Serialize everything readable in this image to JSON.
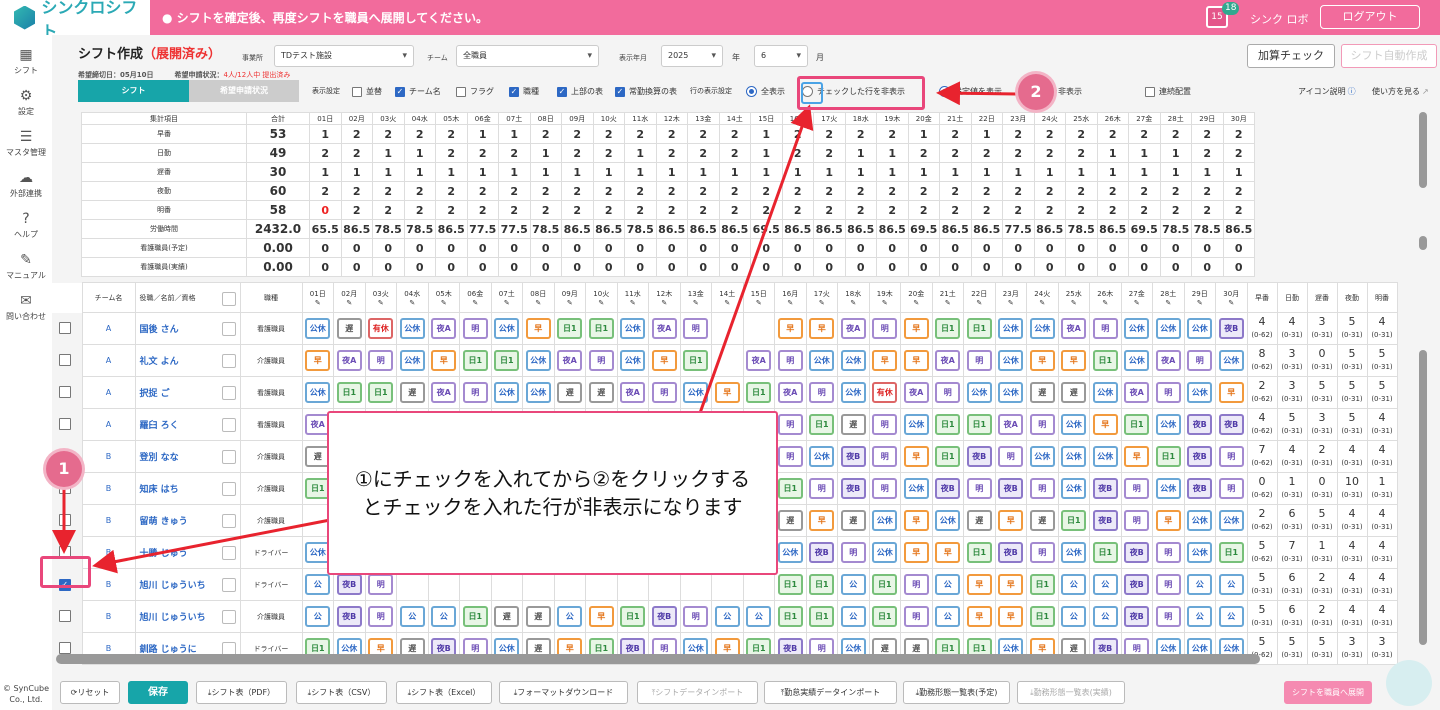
{
  "header": {
    "logo": "シンクロシフト",
    "message": "シフトを確定後、再度シフトを職員へ展開してください。",
    "cal_num": "15",
    "badge": "18",
    "user": "シンク ロボ",
    "logout": "ログアウト"
  },
  "sidebar": [
    {
      "label": "シフト",
      "icon": "calendar-icon"
    },
    {
      "label": "設定",
      "icon": "gear-icon"
    },
    {
      "label": "マスタ管理",
      "icon": "database-icon"
    },
    {
      "label": "外部連携",
      "icon": "cloud-icon"
    },
    {
      "label": "ヘルプ",
      "icon": "help-icon"
    },
    {
      "label": "マニュアル",
      "icon": "pencil-icon"
    },
    {
      "label": "問い合わせ",
      "icon": "mail-icon"
    }
  ],
  "copyright": "© SynCube Co., Ltd.",
  "page": {
    "title": "シフト作成",
    "status": "（展開済み）",
    "deadline": "希望締切日：05月10日",
    "request_label": "希望申請状況：",
    "request_value": "4人/12人中 提出済み"
  },
  "filters": {
    "office_label": "事業所",
    "office": "TDテスト施設",
    "team_label": "チーム",
    "team": "全職員",
    "ym_label": "表示年月",
    "year": "2025",
    "year_unit": "年",
    "month": "6",
    "month_unit": "月"
  },
  "buttons": {
    "calc": "加算チェック",
    "auto": "シフト自動作成"
  },
  "tabs": {
    "shift": "シフト",
    "request": "希望申請状況"
  },
  "options": {
    "display_label": "表示設定",
    "sort": "並替",
    "team_name": "チーム名",
    "flag": "フラグ",
    "job": "職種",
    "top_table": "上部の表",
    "fulltime": "常勤換算の表",
    "row_label": "行の表示設定",
    "show_all": "全表示",
    "hide_checked": "チェックした行を非表示",
    "show_set": "設定値を表示",
    "hide_set": "値を非表示",
    "consec": "連続配置",
    "icon_help": "アイコン説明",
    "usage": "使い方を見る"
  },
  "days": [
    "01日",
    "02月",
    "03火",
    "04水",
    "05木",
    "06金",
    "07土",
    "08日",
    "09月",
    "10火",
    "11水",
    "12木",
    "13金",
    "14土",
    "15日",
    "16月",
    "17火",
    "18水",
    "19木",
    "20金",
    "21土",
    "22日",
    "23月",
    "24火",
    "25水",
    "26木",
    "27金",
    "28土",
    "29日",
    "30月"
  ],
  "summary": {
    "header": "集計項目",
    "total_label": "合計",
    "rows": [
      {
        "label": "早番",
        "total": "53",
        "values": [
          "1",
          "2",
          "2",
          "2",
          "2",
          "1",
          "1",
          "2",
          "2",
          "2",
          "2",
          "2",
          "2",
          "2",
          "1",
          "2",
          "2",
          "2",
          "2",
          "1",
          "2",
          "1",
          "2",
          "2",
          "2",
          "2",
          "2",
          "2",
          "2",
          "2"
        ]
      },
      {
        "label": "日勤",
        "total": "49",
        "values": [
          "2",
          "2",
          "1",
          "1",
          "2",
          "2",
          "2",
          "1",
          "2",
          "2",
          "1",
          "2",
          "2",
          "2",
          "1",
          "2",
          "2",
          "1",
          "1",
          "2",
          "2",
          "2",
          "2",
          "2",
          "2",
          "1",
          "1",
          "1",
          "2",
          "2"
        ]
      },
      {
        "label": "遅番",
        "total": "30",
        "values": [
          "1",
          "1",
          "1",
          "1",
          "1",
          "1",
          "1",
          "1",
          "1",
          "1",
          "1",
          "1",
          "1",
          "1",
          "1",
          "1",
          "1",
          "1",
          "1",
          "1",
          "1",
          "1",
          "1",
          "1",
          "1",
          "1",
          "1",
          "1",
          "1",
          "1"
        ]
      },
      {
        "label": "夜勤",
        "total": "60",
        "values": [
          "2",
          "2",
          "2",
          "2",
          "2",
          "2",
          "2",
          "2",
          "2",
          "2",
          "2",
          "2",
          "2",
          "2",
          "2",
          "2",
          "2",
          "2",
          "2",
          "2",
          "2",
          "2",
          "2",
          "2",
          "2",
          "2",
          "2",
          "2",
          "2",
          "2"
        ]
      },
      {
        "label": "明番",
        "total": "58",
        "values": [
          "0",
          "2",
          "2",
          "2",
          "2",
          "2",
          "2",
          "2",
          "2",
          "2",
          "2",
          "2",
          "2",
          "2",
          "2",
          "2",
          "2",
          "2",
          "2",
          "2",
          "2",
          "2",
          "2",
          "2",
          "2",
          "2",
          "2",
          "2",
          "2",
          "2"
        ]
      },
      {
        "label": "労働時間",
        "total": "2432.0",
        "values": [
          "65.5",
          "86.5",
          "78.5",
          "78.5",
          "86.5",
          "77.5",
          "77.5",
          "78.5",
          "86.5",
          "86.5",
          "78.5",
          "86.5",
          "86.5",
          "86.5",
          "69.5",
          "86.5",
          "86.5",
          "86.5",
          "86.5",
          "69.5",
          "86.5",
          "86.5",
          "77.5",
          "86.5",
          "78.5",
          "86.5",
          "69.5",
          "78.5",
          "78.5",
          "86.5"
        ]
      },
      {
        "label": "看護職員(予定)",
        "total": "0.00",
        "values": [
          "0",
          "0",
          "0",
          "0",
          "0",
          "0",
          "0",
          "0",
          "0",
          "0",
          "0",
          "0",
          "0",
          "0",
          "0",
          "0",
          "0",
          "0",
          "0",
          "0",
          "0",
          "0",
          "0",
          "0",
          "0",
          "0",
          "0",
          "0",
          "0",
          "0"
        ]
      },
      {
        "label": "看護職員(実績)",
        "total": "0.00",
        "values": [
          "0",
          "0",
          "0",
          "0",
          "0",
          "0",
          "0",
          "0",
          "0",
          "0",
          "0",
          "0",
          "0",
          "0",
          "0",
          "0",
          "0",
          "0",
          "0",
          "0",
          "0",
          "0",
          "0",
          "0",
          "0",
          "0",
          "0",
          "0",
          "0",
          "0"
        ]
      }
    ]
  },
  "staff_header": {
    "team": "チーム名",
    "name": "役職／名前／資格",
    "job": "職種",
    "stats": [
      "早番",
      "日勤",
      "遅番",
      "夜勤",
      "明番"
    ]
  },
  "staff": [
    {
      "team": "A",
      "name": "国後 さん",
      "job": "看護職員",
      "checked": false,
      "shifts": [
        "公休",
        "遅",
        "有休",
        "公休",
        "夜A",
        "明",
        "公休",
        "早",
        "日1",
        "日1",
        "公休",
        "夜A",
        "明",
        "",
        "",
        "早",
        "早",
        "夜A",
        "明",
        "早",
        "日1",
        "日1",
        "公休",
        "公休",
        "夜A",
        "明",
        "公休",
        "公休",
        "公休",
        "夜B"
      ],
      "stats": [
        [
          "4",
          "(0-62)"
        ],
        [
          "4",
          "(0-31)"
        ],
        [
          "3",
          "(0-31)"
        ],
        [
          "5",
          "(0-31)"
        ],
        [
          "4",
          "(0-31)"
        ]
      ]
    },
    {
      "team": "A",
      "name": "礼文 よん",
      "job": "介護職員",
      "checked": false,
      "shifts": [
        "早",
        "夜A",
        "明",
        "公休",
        "早",
        "日1",
        "日1",
        "公休",
        "夜A",
        "明",
        "公休",
        "早",
        "日1",
        "",
        "夜A",
        "明",
        "公休",
        "公休",
        "早",
        "早",
        "夜A",
        "明",
        "公休",
        "早",
        "早",
        "日1",
        "公休",
        "夜A",
        "明",
        "公休"
      ],
      "stats": [
        [
          "8",
          "(0-62)"
        ],
        [
          "3",
          "(0-31)"
        ],
        [
          "0",
          "(0-31)"
        ],
        [
          "5",
          "(0-31)"
        ],
        [
          "5",
          "(0-31)"
        ]
      ]
    },
    {
      "team": "A",
      "name": "択捉 ご",
      "job": "看護職員",
      "checked": false,
      "shifts": [
        "公休",
        "日1",
        "日1",
        "遅",
        "夜A",
        "明",
        "公休",
        "公休",
        "遅",
        "遅",
        "夜A",
        "明",
        "公休",
        "早",
        "日1",
        "夜A",
        "明",
        "公休",
        "有休",
        "夜A",
        "明",
        "公休",
        "公休",
        "遅",
        "遅",
        "公休",
        "夜A",
        "明",
        "公休",
        "早"
      ],
      "stats": [
        [
          "2",
          "(0-62)"
        ],
        [
          "3",
          "(0-31)"
        ],
        [
          "5",
          "(0-31)"
        ],
        [
          "5",
          "(0-31)"
        ],
        [
          "5",
          "(0-31)"
        ]
      ]
    },
    {
      "team": "A",
      "name": "羅臼 ろく",
      "job": "看護職員",
      "checked": false,
      "shifts": [
        "夜A",
        "明",
        "",
        "",
        "",
        "",
        "",
        "",
        "",
        "",
        "",
        "",
        "",
        "",
        "",
        "明",
        "日1",
        "遅",
        "明",
        "公休",
        "日1",
        "日1",
        "夜A",
        "明",
        "公休",
        "早",
        "日1",
        "公休",
        "夜B",
        "夜B"
      ],
      "stats": [
        [
          "4",
          "(0-62)"
        ],
        [
          "5",
          "(0-31)"
        ],
        [
          "3",
          "(0-31)"
        ],
        [
          "5",
          "(0-31)"
        ],
        [
          "4",
          "(0-31)"
        ]
      ]
    },
    {
      "team": "B",
      "name": "登別 なな",
      "job": "介護職員",
      "checked": false,
      "shifts": [
        "遅",
        "",
        "",
        "",
        "",
        "",
        "",
        "",
        "",
        "",
        "",
        "",
        "",
        "",
        "",
        "明",
        "公休",
        "夜B",
        "明",
        "早",
        "日1",
        "夜B",
        "明",
        "公休",
        "公休",
        "公休",
        "早",
        "日1",
        "夜B",
        "明"
      ],
      "stats": [
        [
          "7",
          "(0-62)"
        ],
        [
          "4",
          "(0-31)"
        ],
        [
          "2",
          "(0-31)"
        ],
        [
          "4",
          "(0-31)"
        ],
        [
          "4",
          "(0-31)"
        ]
      ]
    },
    {
      "team": "B",
      "name": "知床 はち",
      "job": "介護職員",
      "checked": false,
      "shifts": [
        "日1",
        "",
        "",
        "",
        "",
        "",
        "",
        "",
        "",
        "",
        "",
        "",
        "",
        "",
        "",
        "日1",
        "明",
        "夜B",
        "明",
        "公休",
        "夜B",
        "明",
        "夜B",
        "明",
        "公休",
        "夜B",
        "明",
        "公休",
        "夜B",
        "明"
      ],
      "stats": [
        [
          "0",
          "(0-62)"
        ],
        [
          "1",
          "(0-31)"
        ],
        [
          "0",
          "(0-31)"
        ],
        [
          "10",
          "(0-31)"
        ],
        [
          "1",
          "(0-31)"
        ]
      ]
    },
    {
      "team": "B",
      "name": "留萌 きゅう",
      "job": "介護職員",
      "checked": false,
      "shifts": [
        "",
        "",
        "",
        "",
        "",
        "",
        "",
        "",
        "",
        "",
        "",
        "",
        "",
        "",
        "",
        "遅",
        "早",
        "遅",
        "公休",
        "早",
        "公休",
        "遅",
        "早",
        "遅",
        "日1",
        "夜B",
        "明",
        "早",
        "公休",
        "公休"
      ],
      "stats": [
        [
          "2",
          "(0-62)"
        ],
        [
          "6",
          "(0-31)"
        ],
        [
          "5",
          "(0-31)"
        ],
        [
          "4",
          "(0-31)"
        ],
        [
          "4",
          "(0-31)"
        ]
      ]
    },
    {
      "team": "B",
      "name": "十勝 じゅう",
      "job": "ドライバー",
      "checked": false,
      "shifts": [
        "公休",
        "",
        "",
        "",
        "",
        "",
        "",
        "",
        "",
        "",
        "",
        "",
        "",
        "",
        "",
        "公休",
        "夜B",
        "明",
        "公休",
        "早",
        "早",
        "日1",
        "夜B",
        "明",
        "公休",
        "日1",
        "夜B",
        "明",
        "公休",
        "日1"
      ],
      "stats": [
        [
          "5",
          "(0-62)"
        ],
        [
          "7",
          "(0-31)"
        ],
        [
          "1",
          "(0-31)"
        ],
        [
          "4",
          "(0-31)"
        ],
        [
          "4",
          "(0-31)"
        ]
      ]
    },
    {
      "team": "B",
      "name": "旭川 じゅういち",
      "job": "ドライバー",
      "checked": true,
      "shifts": [
        "公",
        "夜B",
        "明",
        "",
        "",
        "",
        "",
        "",
        "",
        "",
        "",
        "",
        "",
        "",
        "",
        "日1",
        "日1",
        "公",
        "日1",
        "明",
        "公",
        "早",
        "早",
        "日1",
        "公",
        "公",
        "夜B",
        "明",
        "公",
        "公"
      ],
      "stats": [
        [
          "5",
          "(0-31)"
        ],
        [
          "6",
          "(0-31)"
        ],
        [
          "2",
          "(0-31)"
        ],
        [
          "4",
          "(0-31)"
        ],
        [
          "4",
          "(0-31)"
        ]
      ]
    },
    {
      "team": "B",
      "name": "旭川 じゅういち",
      "job": "介護職員",
      "checked": false,
      "shifts": [
        "公",
        "夜B",
        "明",
        "公",
        "公",
        "日1",
        "遅",
        "遅",
        "公",
        "早",
        "日1",
        "夜B",
        "明",
        "公",
        "公",
        "日1",
        "日1",
        "公",
        "日1",
        "明",
        "公",
        "早",
        "早",
        "日1",
        "公",
        "公",
        "夜B",
        "明",
        "公",
        "公"
      ],
      "stats": [
        [
          "5",
          "(0-31)"
        ],
        [
          "6",
          "(0-31)"
        ],
        [
          "2",
          "(0-31)"
        ],
        [
          "4",
          "(0-31)"
        ],
        [
          "4",
          "(0-31)"
        ]
      ]
    },
    {
      "team": "B",
      "name": "釧路 じゅうに",
      "job": "ドライバー",
      "checked": false,
      "shifts": [
        "日1",
        "公休",
        "早",
        "遅",
        "夜B",
        "明",
        "公休",
        "遅",
        "早",
        "日1",
        "夜B",
        "明",
        "公休",
        "早",
        "日1",
        "夜B",
        "明",
        "公休",
        "遅",
        "遅",
        "日1",
        "日1",
        "公休",
        "早",
        "遅",
        "夜B",
        "明",
        "公休",
        "公休",
        "公休"
      ],
      "stats": [
        [
          "5",
          "(0-62)"
        ],
        [
          "5",
          "(0-31)"
        ],
        [
          "5",
          "(0-31)"
        ],
        [
          "3",
          "(0-31)"
        ],
        [
          "3",
          "(0-31)"
        ]
      ]
    }
  ],
  "footer": {
    "reset": "リセット",
    "save": "保存",
    "pdf": "シフト表（PDF）",
    "csv": "シフト表（CSV）",
    "excel": "シフト表（Excel）",
    "format": "フォーマットダウンロード",
    "import": "シフトデータインポート",
    "import_actual": "勤怠実績データインポート",
    "list_plan": "勤務形態一覧表(予定)",
    "list_actual": "勤務形態一覧表(実績)",
    "deploy": "シフトを職員へ展開"
  },
  "annotation": {
    "badge1": "1",
    "badge2": "2",
    "callout_line1": "①にチェックを入れてから②をクリックする",
    "callout_line2": "とチェックを入れた行が非表示になります"
  },
  "colors": {
    "header": "#f26b9c",
    "accent": "#17a5a9",
    "highlight": "#e9477b",
    "arrow": "#e8232e"
  }
}
